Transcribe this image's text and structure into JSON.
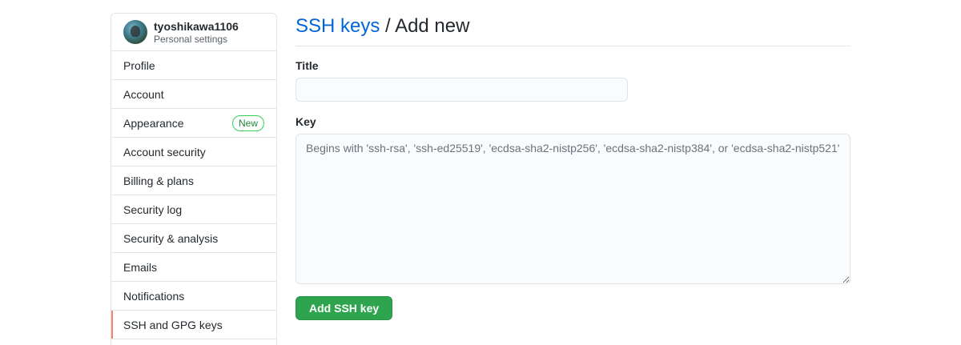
{
  "sidebar": {
    "username": "tyoshikawa1106",
    "subtitle": "Personal settings",
    "items": [
      {
        "label": "Profile"
      },
      {
        "label": "Account"
      },
      {
        "label": "Appearance",
        "badge": "New"
      },
      {
        "label": "Account security"
      },
      {
        "label": "Billing & plans"
      },
      {
        "label": "Security log"
      },
      {
        "label": "Security & analysis"
      },
      {
        "label": "Emails"
      },
      {
        "label": "Notifications"
      },
      {
        "label": "SSH and GPG keys",
        "selected": true
      }
    ]
  },
  "main": {
    "breadcrumb_link": "SSH keys",
    "breadcrumb_sep": " / ",
    "breadcrumb_current": "Add new",
    "title_label": "Title",
    "title_value": "",
    "key_label": "Key",
    "key_placeholder": "Begins with 'ssh-rsa', 'ssh-ed25519', 'ecdsa-sha2-nistp256', 'ecdsa-sha2-nistp384', or 'ecdsa-sha2-nistp521'",
    "submit_label": "Add SSH key"
  },
  "colors": {
    "accent_link": "#0366d6",
    "selected_indicator": "#f9826c",
    "primary_button": "#2ea44f",
    "badge_green": "#22863a"
  }
}
